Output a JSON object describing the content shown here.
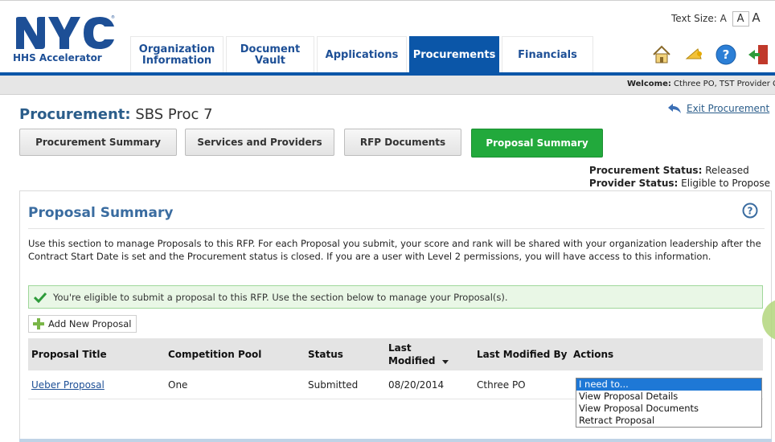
{
  "header": {
    "logo_text": "NYC",
    "logo_subtitle": "HHS Accelerator",
    "text_size_label": "Text Size:",
    "text_size_options": [
      "A",
      "A",
      "A"
    ],
    "nav_tabs": [
      {
        "label": "Organization Information"
      },
      {
        "label": "Document Vault"
      },
      {
        "label": "Applications"
      },
      {
        "label": "Procurements"
      },
      {
        "label": "Financials"
      }
    ],
    "active_tab": "Procurements",
    "welcome_label": "Welcome:",
    "welcome_text": "Cthree PO, TST Provider C"
  },
  "procurement": {
    "title_label": "Procurement:",
    "title_value": "SBS Proc 7",
    "exit_label": "Exit Procurement",
    "subtabs": [
      {
        "label": "Procurement Summary"
      },
      {
        "label": "Services and Providers"
      },
      {
        "label": "RFP Documents"
      },
      {
        "label": "Proposal Summary"
      }
    ],
    "active_subtab": "Proposal Summary",
    "status_label": "Procurement Status:",
    "status_value": "Released",
    "provider_status_label": "Provider Status:",
    "provider_status_value": "Eligible to Propose"
  },
  "panel": {
    "title": "Proposal Summary",
    "description": "Use this section to manage Proposals to this RFP. For each Proposal you submit, your score and rank will be shared with your organization leadership after the Contract Start Date is set and the Procurement status is closed. If you are a user with Level 2 permissions, you will have access to this information.",
    "success_message": "You're eligible to submit a proposal to this RFP. Use the section below to manage your Proposal(s).",
    "add_button": "Add New Proposal",
    "table": {
      "columns": [
        "Proposal Title",
        "Competition Pool",
        "Status",
        "Last Modified",
        "Last Modified By",
        "Actions"
      ],
      "rows": [
        {
          "title": "Ueber Proposal",
          "pool": "One",
          "status": "Submitted",
          "modified": "08/20/2014",
          "modified_by": "Cthree PO"
        }
      ]
    },
    "actions_dropdown": {
      "selected": "I need to...",
      "options": [
        "View Proposal Details",
        "View Proposal Documents",
        "Retract Proposal"
      ]
    }
  },
  "colors": {
    "brand_blue": "#0b56a8",
    "active_green": "#22a93c",
    "title_blue": "#3a6ca0"
  }
}
